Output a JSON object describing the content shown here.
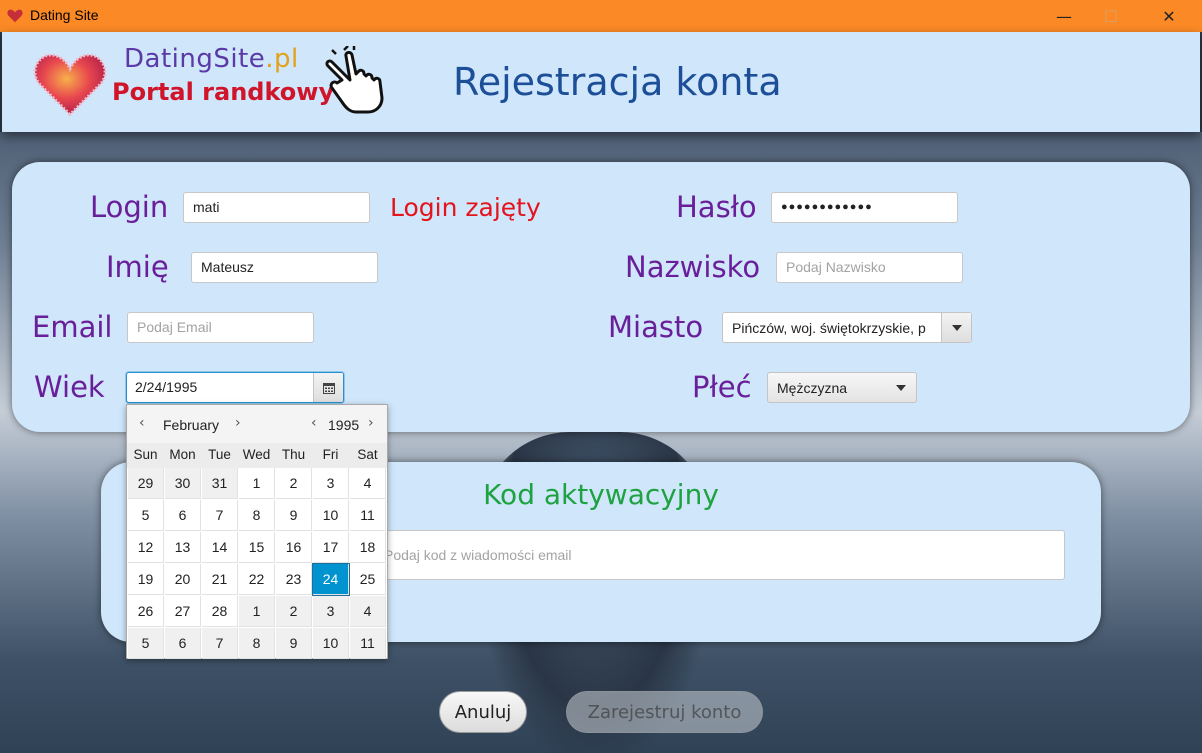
{
  "window": {
    "title": "Dating Site",
    "controls": {
      "minimize": "—",
      "maximize": "☐",
      "close": "✕"
    }
  },
  "header": {
    "brand_name": "DatingSite",
    "brand_tld": ".pl",
    "brand_subtitle": "Portal randkowy",
    "page_title": "Rejestracja konta"
  },
  "form": {
    "login": {
      "label": "Login",
      "value": "mati",
      "error": "Login zajęty"
    },
    "password": {
      "label": "Hasło",
      "value": "●●●●●●●●●●●●"
    },
    "first_name": {
      "label": "Imię",
      "value": "Mateusz"
    },
    "last_name": {
      "label": "Nazwisko",
      "placeholder": "Podaj Nazwisko"
    },
    "email": {
      "label": "Email",
      "placeholder": "Podaj Email"
    },
    "city": {
      "label": "Miasto",
      "value": "Pińczów, woj. świętokrzyskie, p"
    },
    "age": {
      "label": "Wiek",
      "value": "2/24/1995"
    },
    "gender": {
      "label": "Płeć",
      "value": "Mężczyzna"
    }
  },
  "activation": {
    "title": "Kod aktywacyjny",
    "placeholder": "Podaj kod z wiadomości email"
  },
  "buttons": {
    "cancel": "Anuluj",
    "register": "Zarejestruj konto"
  },
  "datepicker": {
    "month": "February",
    "year": "1995",
    "weekdays": [
      "Sun",
      "Mon",
      "Tue",
      "Wed",
      "Thu",
      "Fri",
      "Sat"
    ],
    "weeks": [
      [
        {
          "d": "29",
          "o": true
        },
        {
          "d": "30",
          "o": true
        },
        {
          "d": "31",
          "o": true
        },
        {
          "d": "1"
        },
        {
          "d": "2"
        },
        {
          "d": "3"
        },
        {
          "d": "4"
        }
      ],
      [
        {
          "d": "5"
        },
        {
          "d": "6"
        },
        {
          "d": "7"
        },
        {
          "d": "8"
        },
        {
          "d": "9"
        },
        {
          "d": "10"
        },
        {
          "d": "11"
        }
      ],
      [
        {
          "d": "12"
        },
        {
          "d": "13"
        },
        {
          "d": "14"
        },
        {
          "d": "15"
        },
        {
          "d": "16"
        },
        {
          "d": "17"
        },
        {
          "d": "18"
        }
      ],
      [
        {
          "d": "19"
        },
        {
          "d": "20"
        },
        {
          "d": "21"
        },
        {
          "d": "22"
        },
        {
          "d": "23"
        },
        {
          "d": "24",
          "s": true
        },
        {
          "d": "25"
        }
      ],
      [
        {
          "d": "26"
        },
        {
          "d": "27"
        },
        {
          "d": "28"
        },
        {
          "d": "1",
          "o": true
        },
        {
          "d": "2",
          "o": true
        },
        {
          "d": "3",
          "o": true
        },
        {
          "d": "4",
          "o": true
        }
      ],
      [
        {
          "d": "5",
          "o": true
        },
        {
          "d": "6",
          "o": true
        },
        {
          "d": "7",
          "o": true
        },
        {
          "d": "8",
          "o": true
        },
        {
          "d": "9",
          "o": true
        },
        {
          "d": "10",
          "o": true
        },
        {
          "d": "11",
          "o": true
        }
      ]
    ]
  },
  "colors": {
    "titlebar": "#fb8a26",
    "panel": "#cfe6fb",
    "label": "#6a1f9a",
    "error": "#e5141c",
    "accent": "#0093d0",
    "kod_title": "#1fa241"
  }
}
